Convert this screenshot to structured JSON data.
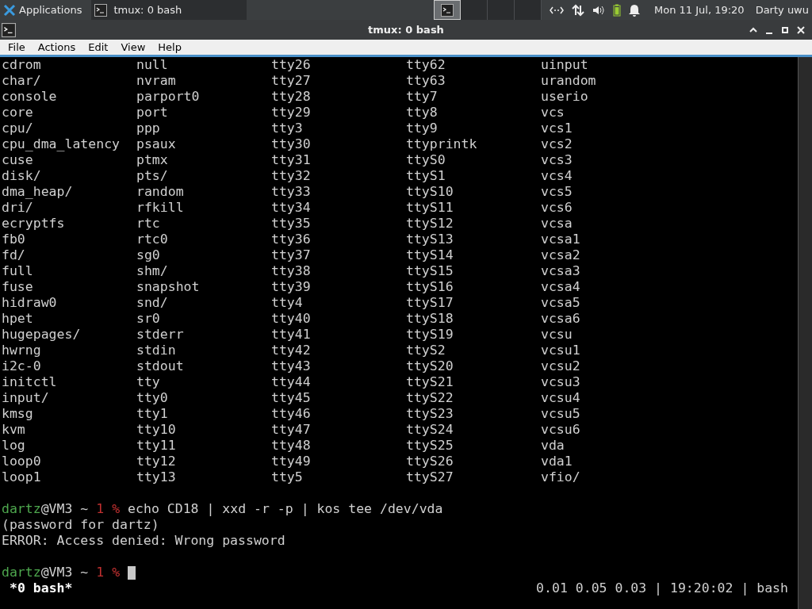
{
  "panel": {
    "menu": "Applications",
    "tasks": [
      {
        "label": "tmux: 0 bash",
        "selected": true
      }
    ],
    "workspaces": [
      {
        "selected": true
      },
      {
        "selected": false
      },
      {
        "selected": false
      },
      {
        "selected": false
      }
    ],
    "clock": "Mon 11 Jul, 19:20",
    "user": "Darty uwu"
  },
  "window": {
    "title": "tmux: 0 bash",
    "menu": [
      "File",
      "Actions",
      "Edit",
      "View",
      "Help"
    ]
  },
  "terminal": {
    "lines": [
      {
        "kind": "listing",
        "cells": [
          "cdrom",
          "null",
          "tty26",
          "tty62",
          "uinput"
        ]
      },
      {
        "kind": "listing",
        "cells": [
          "char/",
          "nvram",
          "tty27",
          "tty63",
          "urandom"
        ]
      },
      {
        "kind": "listing",
        "cells": [
          "console",
          "parport0",
          "tty28",
          "tty7",
          "userio"
        ]
      },
      {
        "kind": "listing",
        "cells": [
          "core",
          "port",
          "tty29",
          "tty8",
          "vcs"
        ]
      },
      {
        "kind": "listing",
        "cells": [
          "cpu/",
          "ppp",
          "tty3",
          "tty9",
          "vcs1"
        ]
      },
      {
        "kind": "listing",
        "cells": [
          "cpu_dma_latency",
          "psaux",
          "tty30",
          "ttyprintk",
          "vcs2"
        ]
      },
      {
        "kind": "listing",
        "cells": [
          "cuse",
          "ptmx",
          "tty31",
          "ttyS0",
          "vcs3"
        ]
      },
      {
        "kind": "listing",
        "cells": [
          "disk/",
          "pts/",
          "tty32",
          "ttyS1",
          "vcs4"
        ]
      },
      {
        "kind": "listing",
        "cells": [
          "dma_heap/",
          "random",
          "tty33",
          "ttyS10",
          "vcs5"
        ]
      },
      {
        "kind": "listing",
        "cells": [
          "dri/",
          "rfkill",
          "tty34",
          "ttyS11",
          "vcs6"
        ]
      },
      {
        "kind": "listing",
        "cells": [
          "ecryptfs",
          "rtc",
          "tty35",
          "ttyS12",
          "vcsa"
        ]
      },
      {
        "kind": "listing",
        "cells": [
          "fb0",
          "rtc0",
          "tty36",
          "ttyS13",
          "vcsa1"
        ]
      },
      {
        "kind": "listing",
        "cells": [
          "fd/",
          "sg0",
          "tty37",
          "ttyS14",
          "vcsa2"
        ]
      },
      {
        "kind": "listing",
        "cells": [
          "full",
          "shm/",
          "tty38",
          "ttyS15",
          "vcsa3"
        ]
      },
      {
        "kind": "listing",
        "cells": [
          "fuse",
          "snapshot",
          "tty39",
          "ttyS16",
          "vcsa4"
        ]
      },
      {
        "kind": "listing",
        "cells": [
          "hidraw0",
          "snd/",
          "tty4",
          "ttyS17",
          "vcsa5"
        ]
      },
      {
        "kind": "listing",
        "cells": [
          "hpet",
          "sr0",
          "tty40",
          "ttyS18",
          "vcsa6"
        ]
      },
      {
        "kind": "listing",
        "cells": [
          "hugepages/",
          "stderr",
          "tty41",
          "ttyS19",
          "vcsu"
        ]
      },
      {
        "kind": "listing",
        "cells": [
          "hwrng",
          "stdin",
          "tty42",
          "ttyS2",
          "vcsu1"
        ]
      },
      {
        "kind": "listing",
        "cells": [
          "i2c-0",
          "stdout",
          "tty43",
          "ttyS20",
          "vcsu2"
        ]
      },
      {
        "kind": "listing",
        "cells": [
          "initctl",
          "tty",
          "tty44",
          "ttyS21",
          "vcsu3"
        ]
      },
      {
        "kind": "listing",
        "cells": [
          "input/",
          "tty0",
          "tty45",
          "ttyS22",
          "vcsu4"
        ]
      },
      {
        "kind": "listing",
        "cells": [
          "kmsg",
          "tty1",
          "tty46",
          "ttyS23",
          "vcsu5"
        ]
      },
      {
        "kind": "listing",
        "cells": [
          "kvm",
          "tty10",
          "tty47",
          "ttyS24",
          "vcsu6"
        ]
      },
      {
        "kind": "listing",
        "cells": [
          "log",
          "tty11",
          "tty48",
          "ttyS25",
          "vda"
        ]
      },
      {
        "kind": "listing",
        "cells": [
          "loop0",
          "tty12",
          "tty49",
          "ttyS26",
          "vda1"
        ]
      },
      {
        "kind": "listing",
        "cells": [
          "loop1",
          "tty13",
          "tty5",
          "ttyS27",
          "vfio/"
        ]
      },
      {
        "kind": "blank"
      },
      {
        "kind": "prompt",
        "user": "dartz",
        "host": "@VM3 ~",
        "status": "1 %",
        "command": "echo CD18 | xxd -r -p | kos tee /dev/vda",
        "cursor": false
      },
      {
        "kind": "output",
        "text": "(password for dartz)"
      },
      {
        "kind": "output",
        "text": "ERROR: Access denied: Wrong password"
      },
      {
        "kind": "blank"
      },
      {
        "kind": "prompt",
        "user": "dartz",
        "host": "@VM3 ~",
        "status": "1 %",
        "cursor": true
      }
    ]
  },
  "status_bar": {
    "window": "*0 bash*",
    "right": "0.01 0.05 0.03 | 19:20:02 | bash"
  }
}
